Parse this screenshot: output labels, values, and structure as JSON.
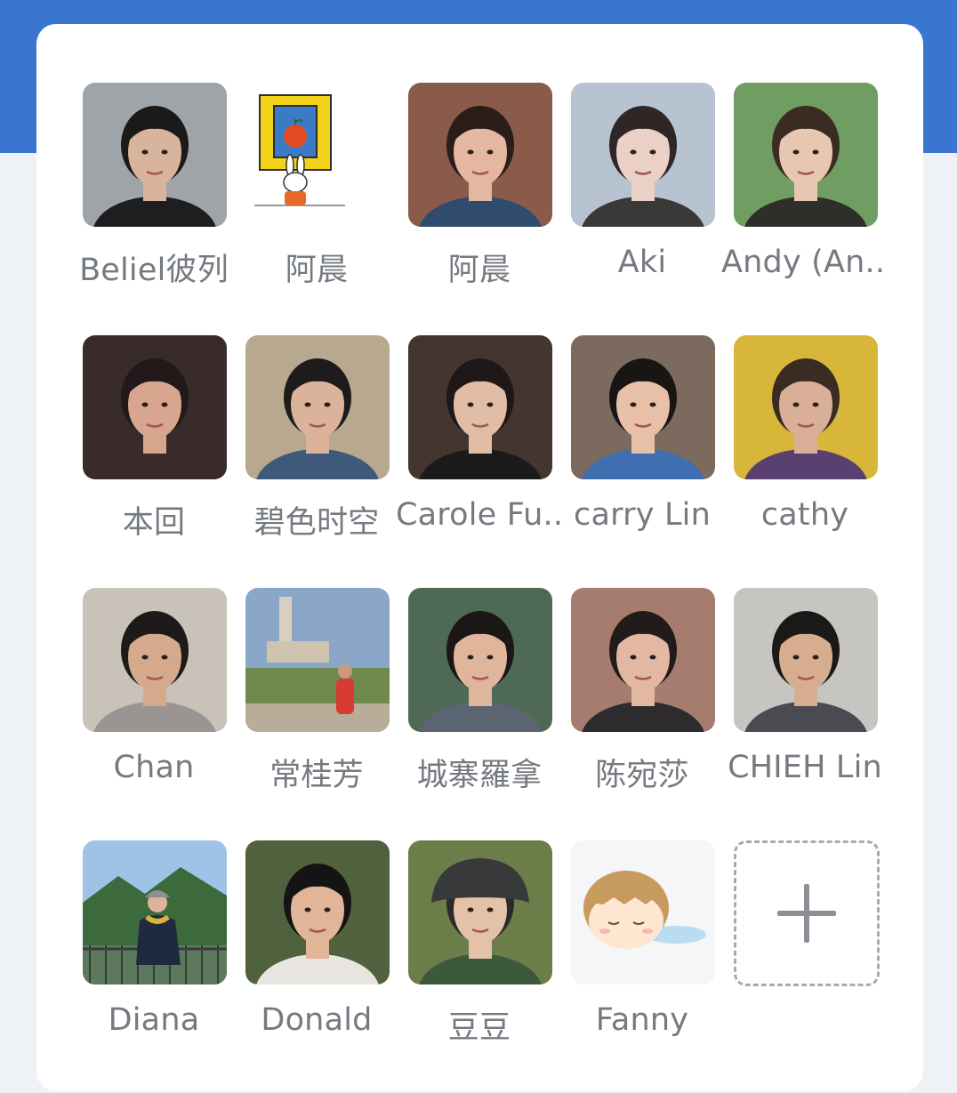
{
  "members": [
    {
      "name": "Beliel彼列",
      "bg": "#9ea4a8",
      "skin": "#d9b49c",
      "hair": "#1c1a19",
      "shirt": "#1e1e20"
    },
    {
      "name": "阿晨",
      "bg": "#ffffff",
      "skin": "#ffffff",
      "hair": "#ffffff",
      "shirt": "#ffffff",
      "type": "cartoon-rabbit"
    },
    {
      "name": "阿晨",
      "bg": "#8a5a4b",
      "skin": "#e3b7a0",
      "hair": "#2a1d1a",
      "shirt": "#2f4b6e"
    },
    {
      "name": "Aki",
      "bg": "#b8c3d2",
      "skin": "#ead0c5",
      "hair": "#2f2725",
      "shirt": "#3b3838"
    },
    {
      "name": "Andy (An...",
      "bg": "#6f9d62",
      "skin": "#e8c7b0",
      "hair": "#3a2c22",
      "shirt": "#2e2f2b"
    },
    {
      "name": "本回",
      "bg": "#3a2b2b",
      "skin": "#d8a68f",
      "hair": "#22191a",
      "shirt": "#3b2a2a"
    },
    {
      "name": "碧色时空",
      "bg": "#b7a88f",
      "skin": "#dab39a",
      "hair": "#1d1b1b",
      "shirt": "#3d5a7a"
    },
    {
      "name": "Carole Fu...",
      "bg": "#44352f",
      "skin": "#e2bda6",
      "hair": "#1f1818",
      "shirt": "#1b1b1b"
    },
    {
      "name": "carry Lin",
      "bg": "#7b6a5d",
      "skin": "#e8c0a8",
      "hair": "#181515",
      "shirt": "#3f6fb0"
    },
    {
      "name": "cathy",
      "bg": "#d8b63a",
      "skin": "#d9b097",
      "hair": "#3b2c23",
      "shirt": "#5a4070"
    },
    {
      "name": "Chan",
      "bg": "#c9c2b8",
      "skin": "#d5aa8c",
      "hair": "#1d1a18",
      "shirt": "#9a9592"
    },
    {
      "name": "常桂芳",
      "bg": "#8aa6c9",
      "skin": "#c99a7e",
      "hair": "#2b2220",
      "shirt": "#d83b32",
      "type": "landscape"
    },
    {
      "name": "城寨羅拿",
      "bg": "#4e6a55",
      "skin": "#dfb69c",
      "hair": "#1a1716",
      "shirt": "#5b6572"
    },
    {
      "name": "陈宛莎",
      "bg": "#a57c6d",
      "skin": "#e2b8a3",
      "hair": "#231b1a",
      "shirt": "#2d2b2e"
    },
    {
      "name": "CHIEH Lin",
      "bg": "#c7c5c2",
      "skin": "#d7ad90",
      "hair": "#1b1918",
      "shirt": "#4a4a50"
    },
    {
      "name": "Diana",
      "bg": "#8fb4d8",
      "skin": "#dcb49a",
      "hair": "#2a2321",
      "shirt": "#1f2a3f",
      "type": "outdoor"
    },
    {
      "name": "Donald",
      "bg": "#50623d",
      "skin": "#e0b598",
      "hair": "#151313",
      "shirt": "#e9e6e2"
    },
    {
      "name": "豆豆",
      "bg": "#6b7e4a",
      "skin": "#e4c2a8",
      "hair": "#2b2a2a",
      "shirt": "#3c5a3a",
      "type": "hat"
    },
    {
      "name": "Fanny",
      "bg": "#f4f6f8",
      "skin": "#fbe5cf",
      "hair": "#c79a5e",
      "shirt": "#9fc8e6",
      "type": "cartoon-girl"
    }
  ],
  "add_tile": {
    "icon": "plus-icon"
  }
}
